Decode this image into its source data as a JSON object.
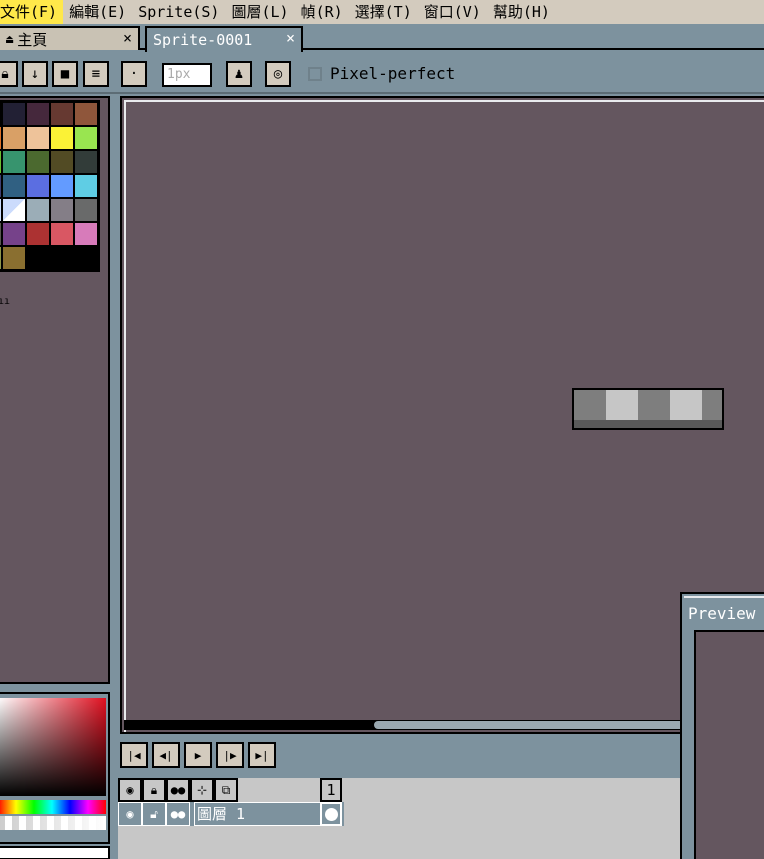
{
  "menu": {
    "items": [
      "文件(F)",
      "編輯(E)",
      "Sprite(S)",
      "圖層(L)",
      "幀(R)",
      "選擇(T)",
      "窗口(V)",
      "幫助(H)"
    ]
  },
  "tabs": {
    "home": {
      "label": "主頁",
      "close": "×"
    },
    "sprite": {
      "label": "Sprite-0001",
      "close": "×"
    }
  },
  "toolbar": {
    "brush_size_placeholder": "1px",
    "pixel_perfect_label": "Pixel-perfect",
    "icons": [
      "lock-icon",
      "arrow-down-icon",
      "square-icon",
      "lines-icon",
      "dot-icon",
      "ink-icon",
      "spiral-icon"
    ]
  },
  "palette": {
    "colors": [
      "#000000",
      "#222034",
      "#45283c",
      "#663931",
      "#8f563b",
      "#df7126",
      "#d9a066",
      "#eec39a",
      "#fbf236",
      "#99e550",
      "#6abe30",
      "#37946e",
      "#4b692f",
      "#524b24",
      "#323c39",
      "#3f3f74",
      "#306082",
      "#5b6ee1",
      "#639bff",
      "#5fcde4",
      "#cbdbfc",
      "#ffffff",
      "#9badb7",
      "#847e87",
      "#696a6a",
      "#595652",
      "#76428a",
      "#ac3232",
      "#d95763",
      "#d77bba",
      "#8f974a",
      "#8a6f30"
    ],
    "note": "ıı"
  },
  "timeline": {
    "frame_number": "1",
    "layer_name": "圖層 1",
    "playback_icons": [
      "first-frame-icon",
      "prev-frame-icon",
      "play-icon",
      "next-frame-icon",
      "last-frame-icon"
    ]
  },
  "preview": {
    "title": "Preview"
  }
}
